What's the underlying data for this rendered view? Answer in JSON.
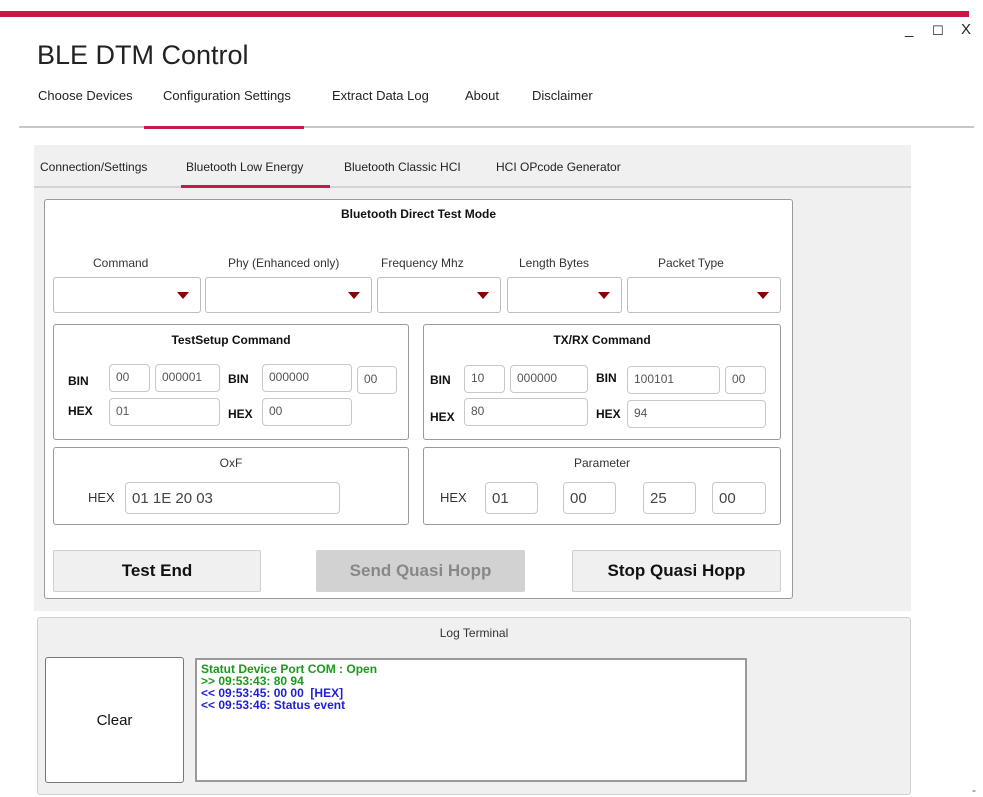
{
  "window": {
    "title": "BLE DTM Control",
    "controls": {
      "minimize": "_",
      "maximize": "☐",
      "close": "X"
    }
  },
  "main_nav": {
    "active": "Configuration Settings",
    "items": [
      "Choose Devices",
      "Configuration Settings",
      "Extract Data Log",
      "About",
      "Disclaimer"
    ]
  },
  "sub_tabs": {
    "active": "Bluetooth Low Energy",
    "items": [
      "Connection/Settings",
      "Bluetooth Low Energy",
      "Bluetooth Classic HCI",
      "HCI OPcode Generator"
    ]
  },
  "dtm": {
    "title": "Bluetooth Direct Test Mode",
    "selectors": [
      {
        "label": "Command",
        "value": ""
      },
      {
        "label": "Phy (Enhanced only)",
        "value": ""
      },
      {
        "label": "Frequency Mhz",
        "value": ""
      },
      {
        "label": "Length Bytes",
        "value": ""
      },
      {
        "label": "Packet Type",
        "value": ""
      }
    ],
    "testsetup": {
      "title": "TestSetup Command",
      "bin_label": "BIN",
      "hex_label": "HEX",
      "bin1a": "00",
      "bin1b": "000001",
      "bin2a": "000000",
      "bin2b": "00",
      "hex1": "01",
      "hex2": "00"
    },
    "txrx": {
      "title": "TX/RX Command",
      "bin_label": "BIN",
      "hex_label": "HEX",
      "bin1a": "10",
      "bin1b": "000000",
      "bin2a": "100101",
      "bin2b": "00",
      "hex1": "80",
      "hex2": "94"
    },
    "oxf": {
      "title": "OxF",
      "hex_label": "HEX",
      "value": "01 1E 20 03"
    },
    "parameter": {
      "title": "Parameter",
      "hex_label": "HEX",
      "values": [
        "01",
        "00",
        "25",
        "00"
      ]
    },
    "buttons": {
      "test_end": "Test End",
      "send_quasi_hopp": "Send Quasi Hopp",
      "stop_quasi_hopp": "Stop Quasi Hopp"
    }
  },
  "log": {
    "title": "Log Terminal",
    "clear_label": "Clear",
    "lines": [
      {
        "text": "Statut Device Port COM : Open",
        "color": "#1a9a1a"
      },
      {
        "text": ">> 09:53:43: 80 94",
        "color": "#1a9a1a"
      },
      {
        "text": "<< 09:53:45: 00 00  [HEX]",
        "color": "#1f1fd6"
      },
      {
        "text": "<< 09:53:46: Status event",
        "color": "#1f1fd6"
      }
    ]
  },
  "colors": {
    "accent": "#c8184a",
    "combo_arrow": "#8b0000"
  },
  "misc": {
    "edge_dash": "-"
  }
}
